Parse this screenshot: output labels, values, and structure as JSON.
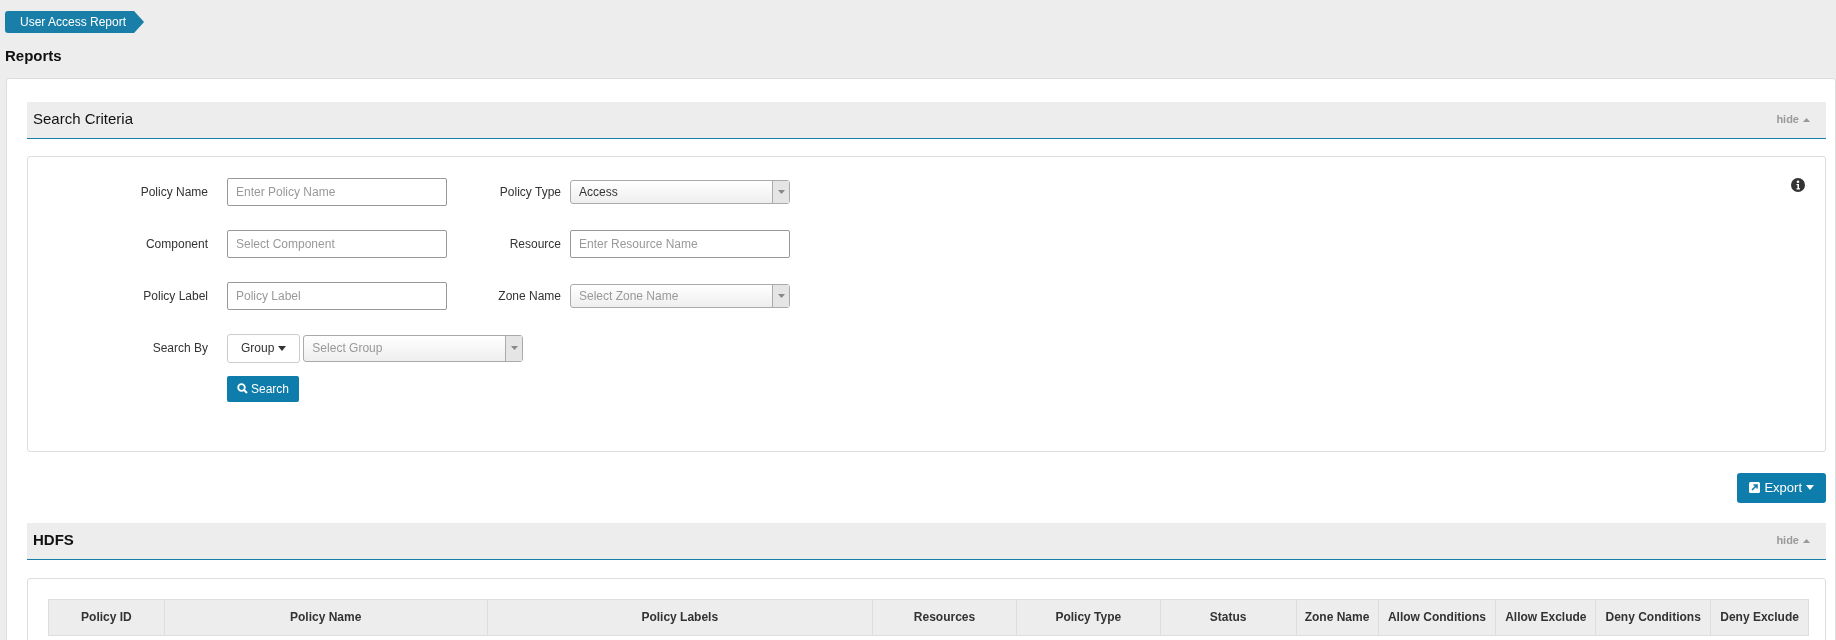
{
  "breadcrumb": "User Access Report",
  "page_title": "Reports",
  "search_panel": {
    "title": "Search Criteria",
    "hide_label": "hide",
    "rows": [
      [
        {
          "label": "Policy Name",
          "kind": "text",
          "placeholder": "Enter Policy Name"
        },
        {
          "label": "Policy Type",
          "kind": "select",
          "value": "Access"
        }
      ],
      [
        {
          "label": "Component",
          "kind": "text",
          "placeholder": "Select Component"
        },
        {
          "label": "Resource",
          "kind": "text",
          "placeholder": "Enter Resource Name"
        }
      ],
      [
        {
          "label": "Policy Label",
          "kind": "text",
          "placeholder": "Policy Label"
        },
        {
          "label": "Zone Name",
          "kind": "select",
          "placeholder": "Select Zone Name"
        }
      ]
    ],
    "search_by": {
      "label": "Search By",
      "type_button": "Group",
      "placeholder": "Select Group"
    },
    "search_button": "Search"
  },
  "export_button": "Export",
  "results": {
    "title": "HDFS",
    "hide_label": "hide",
    "columns": [
      "Policy ID",
      "Policy Name",
      "Policy Labels",
      "Resources",
      "Policy Type",
      "Status",
      "Zone Name",
      "Allow Conditions",
      "Allow Exclude",
      "Deny Conditions",
      "Deny Exclude"
    ]
  }
}
